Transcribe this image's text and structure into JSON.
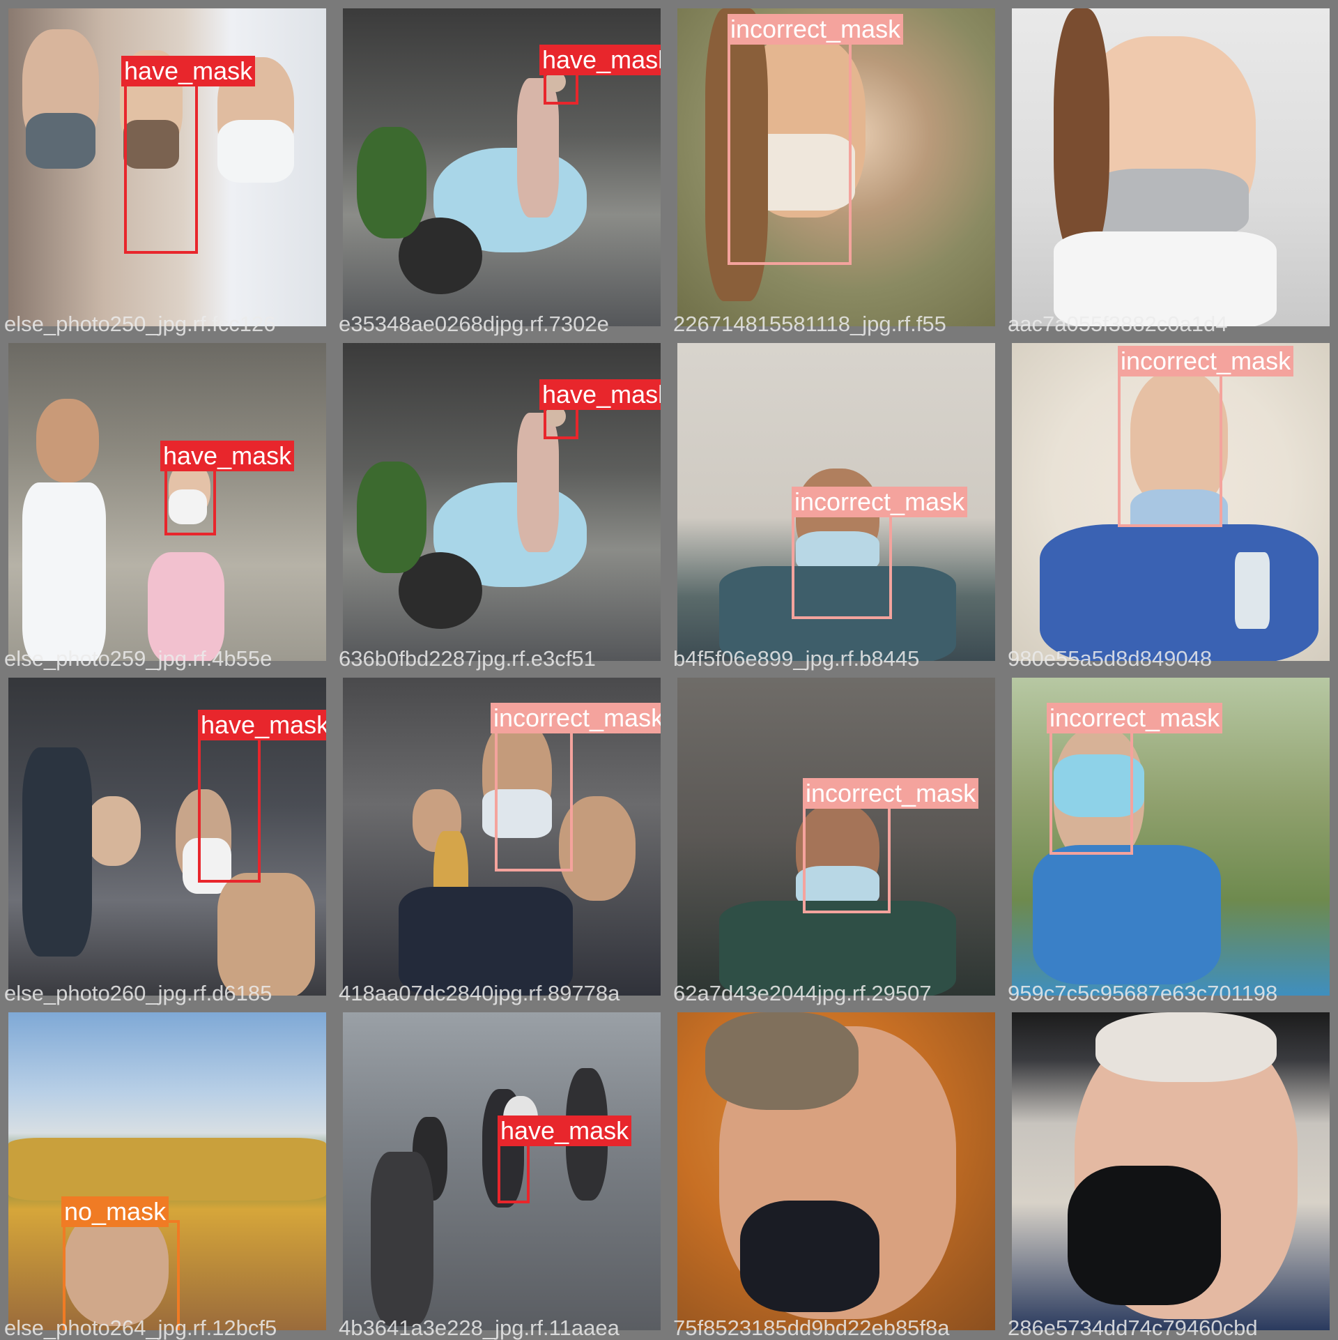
{
  "colors": {
    "have_mask": "#e8262c",
    "incorrect_mask": "#f4a39d",
    "no_mask": "#f07b24",
    "background": "#7a7a7a"
  },
  "tiles": [
    {
      "scene": "three people wearing masks",
      "filename": "else_photo250_jpg.rf.fcc126",
      "detections": [
        {
          "label": "have_mask",
          "cls": "have_mask"
        }
      ]
    },
    {
      "scene": "woman on scooter",
      "filename": "e35348ae0268djpg.rf.7302e",
      "detections": [
        {
          "label": "have_mask",
          "cls": "have_mask"
        }
      ]
    },
    {
      "scene": "woman mask below nose",
      "filename": "226714815581118_jpg.rf.f55",
      "detections": [
        {
          "label": "incorrect_mask",
          "cls": "incorrect_mask"
        }
      ]
    },
    {
      "scene": "smiling nurse",
      "filename": "aac7a055f3882c0a1d4",
      "detections": []
    },
    {
      "scene": "crowd girl with mask",
      "filename": "else_photo259_jpg.rf.4b55e",
      "detections": [
        {
          "label": "have_mask",
          "cls": "have_mask"
        }
      ]
    },
    {
      "scene": "woman on scooter",
      "filename": "636b0fbd2287jpg.rf.e3cf51",
      "detections": [
        {
          "label": "have_mask",
          "cls": "have_mask"
        }
      ]
    },
    {
      "scene": "man mask on chin",
      "filename": "b4f5f06e899_jpg.rf.b8445",
      "detections": [
        {
          "label": "incorrect_mask",
          "cls": "incorrect_mask"
        }
      ]
    },
    {
      "scene": "nurse drinking",
      "filename": "980e55a5d8d849048",
      "detections": [
        {
          "label": "incorrect_mask",
          "cls": "incorrect_mask"
        }
      ]
    },
    {
      "scene": "crowd masks",
      "filename": "else_photo260_jpg.rf.d6185",
      "detections": [
        {
          "label": "have_mask",
          "cls": "have_mask"
        }
      ]
    },
    {
      "scene": "speaker microphone",
      "filename": "418aa07dc2840jpg.rf.89778a",
      "detections": [
        {
          "label": "incorrect_mask",
          "cls": "incorrect_mask"
        }
      ]
    },
    {
      "scene": "man mask on chin dark room",
      "filename": "62a7d43e2044jpg.rf.29507",
      "detections": [
        {
          "label": "incorrect_mask",
          "cls": "incorrect_mask"
        }
      ]
    },
    {
      "scene": "man mask over eyes",
      "filename": "959c7c5c95687e63c701198",
      "detections": [
        {
          "label": "incorrect_mask",
          "cls": "incorrect_mask"
        }
      ]
    },
    {
      "scene": "man by fence",
      "filename": "else_photo264_jpg.rf.12bcf5",
      "detections": [
        {
          "label": "no_mask",
          "cls": "no_mask"
        }
      ]
    },
    {
      "scene": "street walkers",
      "filename": "4b3641a3e228_jpg.rf.11aaea",
      "detections": [
        {
          "label": "have_mask",
          "cls": "have_mask"
        }
      ]
    },
    {
      "scene": "man black mask chin",
      "filename": "75f8523185dd9bd22eb85f8a",
      "detections": []
    },
    {
      "scene": "old man black mask",
      "filename": "286e5734dd74c79460cbd",
      "detections": []
    }
  ]
}
